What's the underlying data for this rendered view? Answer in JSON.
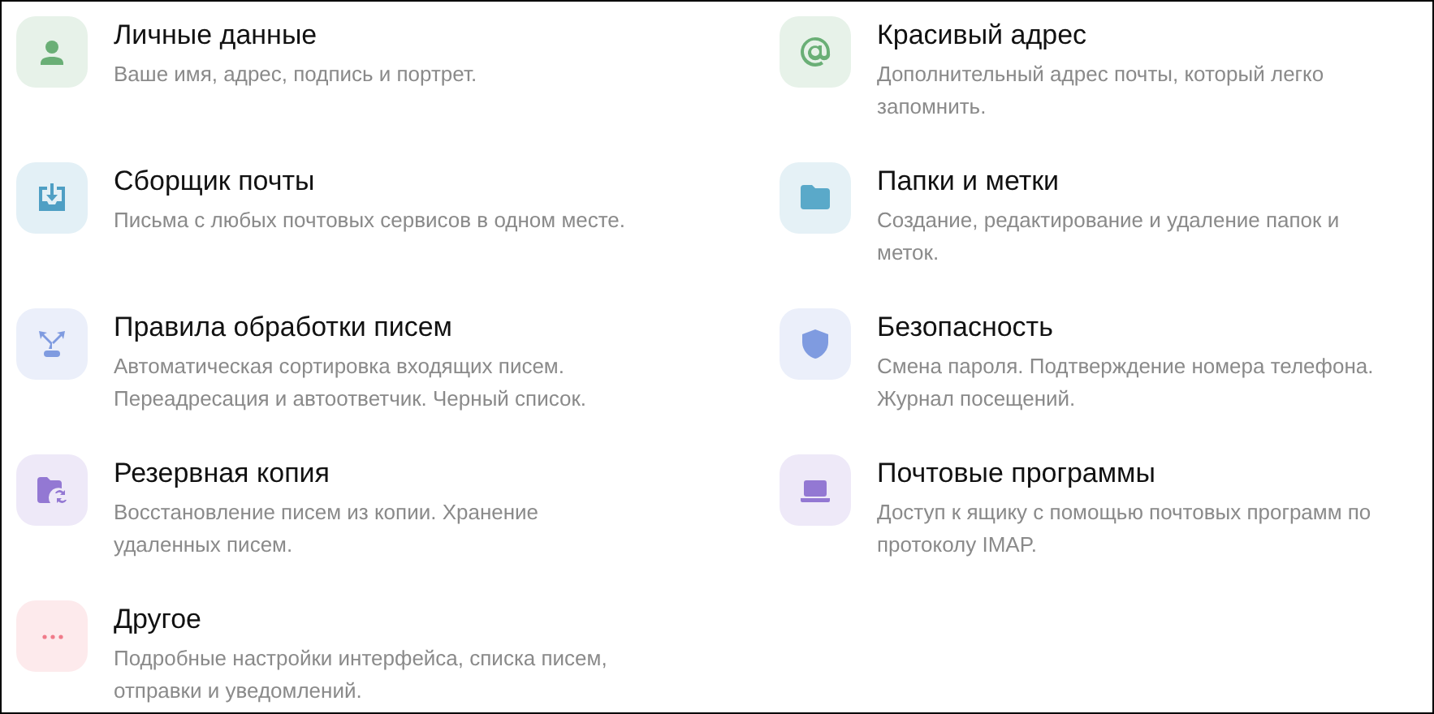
{
  "sections": [
    {
      "title": "Личные данные",
      "description": "Ваше имя, адрес, подпись и портрет.",
      "color": "#6aaf76"
    },
    {
      "title": "Красивый адрес",
      "description": "Дополнительный адрес почты, который легко\nзапомнить.",
      "color": "#6aaf76"
    },
    {
      "title": "Сборщик почты",
      "description": "Письма с любых почтовых сервисов в одном месте.",
      "color": "#4f9fc4"
    },
    {
      "title": "Папки и метки",
      "description": "Создание, редактирование и удаление папок и\nметок.",
      "color": "#5aa9c9"
    },
    {
      "title": "Правила обработки писем",
      "description": "Автоматическая сортировка входящих писем.\nПереадресация и автоответчик. Черный список.",
      "color": "#7f9be0"
    },
    {
      "title": "Безопасность",
      "description": "Смена пароля. Подтверждение номера телефона.\nЖурнал посещений.",
      "color": "#7f9be0"
    },
    {
      "title": "Резервная копия",
      "description": "Восстановление писем из копии. Хранение\nудаленных писем.",
      "color": "#9378d3"
    },
    {
      "title": "Почтовые программы",
      "description": "Доступ к ящику с помощью почтовых программ по\nпротоколу IMAP.",
      "color": "#9378d3"
    },
    {
      "title": "Другое",
      "description": "Подробные настройки интерфейса, списка писем,\nотправки и уведомлений.",
      "color": "#f07b8a"
    }
  ]
}
